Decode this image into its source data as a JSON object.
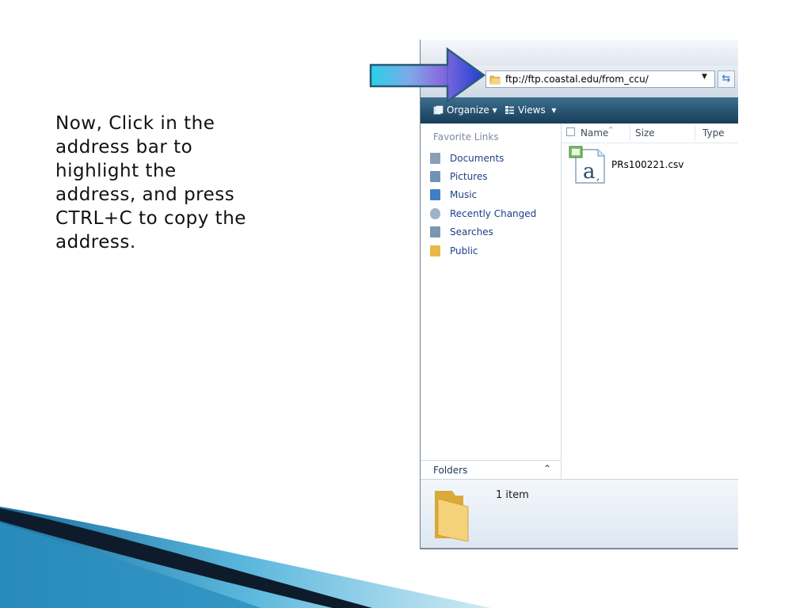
{
  "slide": {
    "instruction_lines": [
      "Now, Click in the",
      "address bar to",
      "highlight the",
      "address, and press",
      "CTRL+C to copy the",
      "address."
    ]
  },
  "explorer": {
    "address": {
      "value": "ftp://ftp.coastal.edu/from_ccu/"
    },
    "toolbar": {
      "organize_label": "Organize",
      "views_label": "Views"
    },
    "nav": {
      "favorites_title": "Favorite Links",
      "items": [
        {
          "label": "Documents",
          "icon": "documents-icon"
        },
        {
          "label": "Pictures",
          "icon": "pictures-icon"
        },
        {
          "label": "Music",
          "icon": "music-icon"
        },
        {
          "label": "Recently Changed",
          "icon": "recently-changed-icon"
        },
        {
          "label": "Searches",
          "icon": "searches-icon"
        },
        {
          "label": "Public",
          "icon": "public-folder-icon"
        }
      ],
      "folders_label": "Folders"
    },
    "columns": [
      "Name",
      "Size",
      "Type"
    ],
    "files": [
      {
        "name": "PRs100221.csv",
        "icon": "csv-file-icon"
      }
    ],
    "details": {
      "count_label": "1 item"
    }
  },
  "colors": {
    "command_bar": "#1f4a68",
    "arrow_blue": "#1f3fd0",
    "arrow_cyan": "#2ad0e8"
  }
}
